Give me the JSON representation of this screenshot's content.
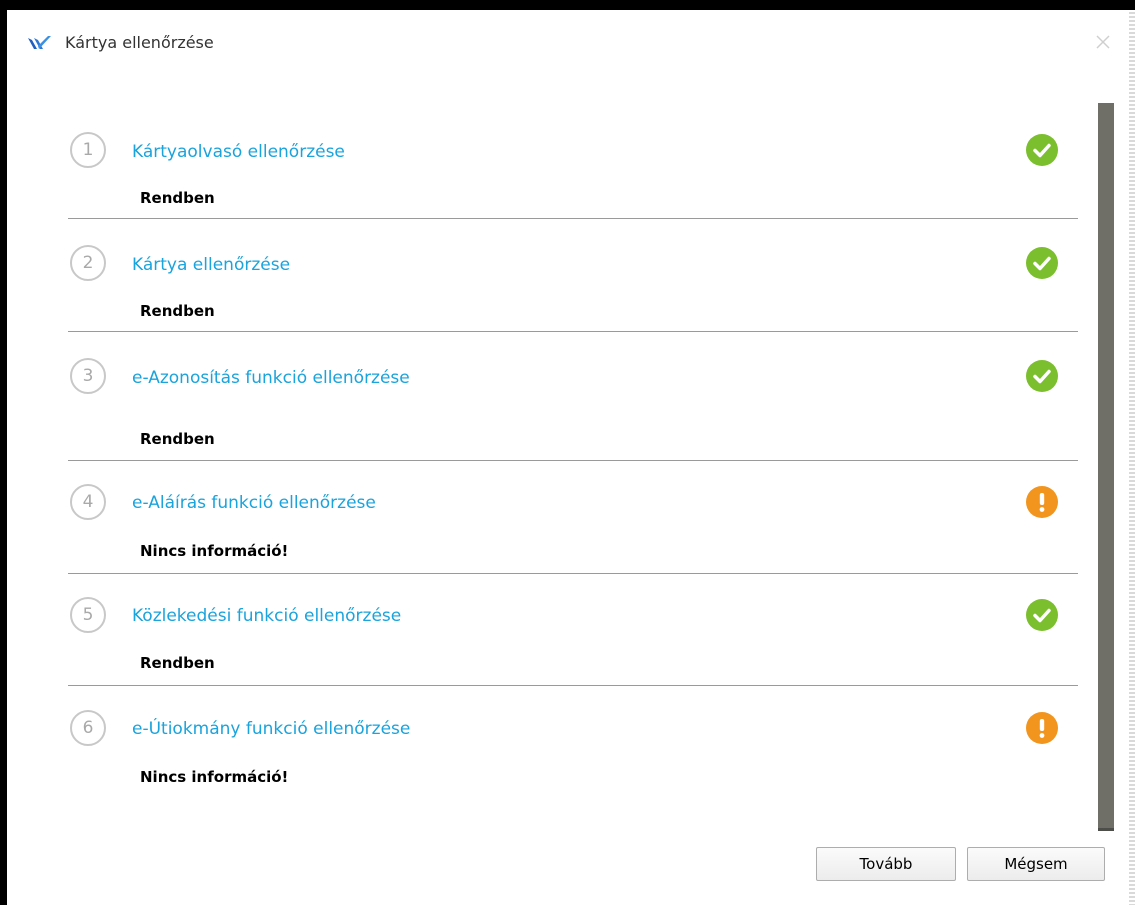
{
  "window": {
    "title": "Kártya ellenőrzése",
    "close_icon": "close-icon",
    "logo_icon": "app-logo-icon"
  },
  "colors": {
    "title_blue": "#1aa3dc",
    "ok_green": "#7bbf2f",
    "warn_orange": "#f2951e",
    "scrollbar": "#6f6f68"
  },
  "steps": [
    {
      "number": "1",
      "title": "Kártyaolvasó ellenőrzése",
      "status": "Rendben",
      "icon": "check-icon"
    },
    {
      "number": "2",
      "title": "Kártya ellenőrzése",
      "status": "Rendben",
      "icon": "check-icon"
    },
    {
      "number": "3",
      "title": "e-Azonosítás funkció ellenőrzése",
      "status": "Rendben",
      "icon": "check-icon"
    },
    {
      "number": "4",
      "title": "e-Aláírás funkció ellenőrzése",
      "status": "Nincs információ!",
      "icon": "warning-icon"
    },
    {
      "number": "5",
      "title": "Közlekedési funkció ellenőrzése",
      "status": "Rendben",
      "icon": "check-icon"
    },
    {
      "number": "6",
      "title": "e-Útiokmány funkció ellenőrzése",
      "status": "Nincs információ!",
      "icon": "warning-icon"
    }
  ],
  "buttons": {
    "next_label": "Tovább",
    "cancel_label": "Mégsem"
  }
}
